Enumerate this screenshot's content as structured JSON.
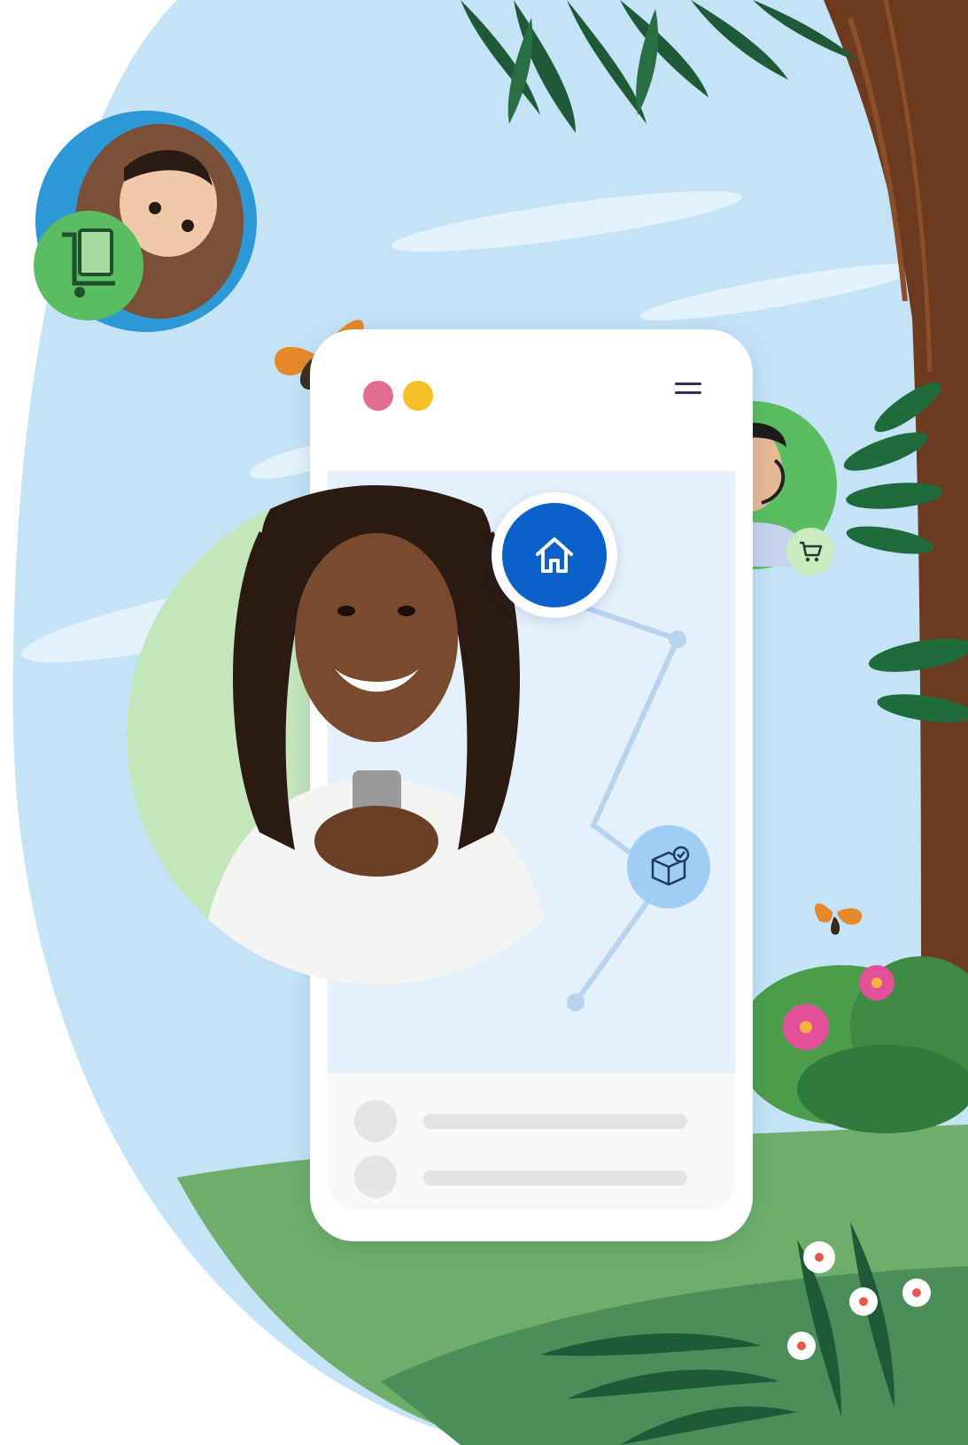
{
  "colors": {
    "sky": "#c4e3f7",
    "phone_dot_pink": "#e06d8f",
    "phone_dot_yellow": "#f5c025",
    "home_button": "#0b61c9",
    "delivery_button": "#9fcdf3",
    "avatar_green": "#5bbd61",
    "foliage_dark": "#1f5a38",
    "trunk": "#6b3a1f"
  },
  "icons": {
    "home": "home-icon",
    "delivery": "package-check-icon",
    "cart": "shopping-cart-icon",
    "hand_truck": "hand-truck-icon",
    "menu": "hamburger-menu-icon"
  }
}
